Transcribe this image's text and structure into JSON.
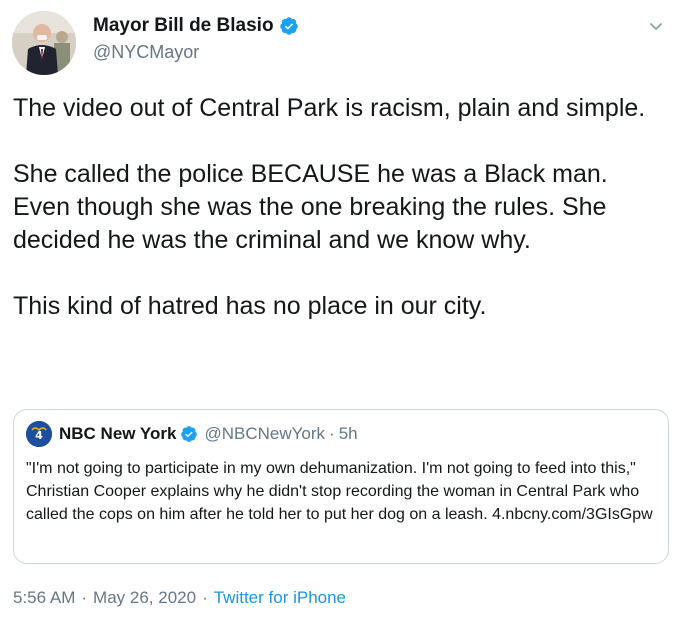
{
  "author": {
    "display_name": "Mayor Bill de Blasio",
    "handle": "@NYCMayor",
    "verified": true,
    "avatar_icon": "profile-photo"
  },
  "tweet": {
    "paragraphs": [
      "The video out of Central Park is racism, plain and simple.",
      "She called the police BECAUSE he was a Black man. Even though she was the one breaking the rules. She decided he was the criminal and we know why.",
      "This kind of hatred has no place in our city."
    ]
  },
  "quoted_tweet": {
    "logo_text": "4",
    "display_name": "NBC New York",
    "handle": "@NBCNewYork",
    "dot": "·",
    "time": "5h",
    "text": "\"I'm not going to participate in my own dehumanization. I'm not going to feed into this,\" Christian Cooper explains why he didn't stop recording the woman in Central Park who called the cops on him after he told her to put her dog on a leash. 4.nbcny.com/3GIsGpw"
  },
  "meta": {
    "time": "5:56 AM",
    "separator": "·",
    "date": "May 26, 2020",
    "source": "Twitter for iPhone"
  },
  "colors": {
    "verified_blue": "#1da1f2",
    "link_blue": "#1b95e0",
    "secondary_gray": "#657786",
    "border_gray": "#ccd6dd"
  }
}
